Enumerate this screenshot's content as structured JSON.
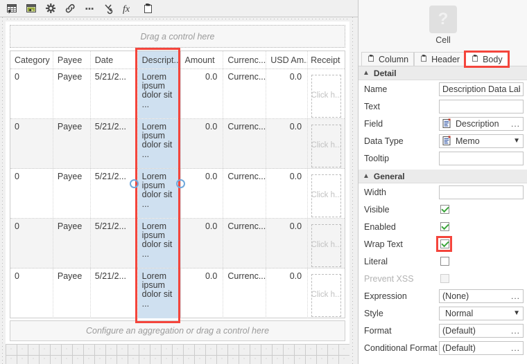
{
  "toolbar": {
    "buttons": [
      {
        "name": "insert-table-icon",
        "title": "Insert Table"
      },
      {
        "name": "insert-image-icon",
        "title": "Insert Image"
      },
      {
        "name": "settings-gear-icon",
        "title": "Settings"
      },
      {
        "name": "link-icon",
        "title": "Link"
      },
      {
        "name": "more-options-icon",
        "title": "More"
      },
      {
        "name": "convert-icon",
        "title": "Convert"
      },
      {
        "name": "function-fx-icon",
        "title": "Function"
      },
      {
        "name": "paste-control-icon",
        "title": "Paste Control"
      }
    ]
  },
  "designer": {
    "header_dropzone": "Drag a control here",
    "footer_dropzone": "Configure an aggregation or drag a control here",
    "table": {
      "columns": [
        {
          "key": "category",
          "header": "Category",
          "align": "left"
        },
        {
          "key": "payee",
          "header": "Payee",
          "align": "left"
        },
        {
          "key": "date",
          "header": "Date",
          "align": "left"
        },
        {
          "key": "description",
          "header": "Descript...",
          "align": "left",
          "selected": true
        },
        {
          "key": "amount",
          "header": "Amount",
          "align": "right"
        },
        {
          "key": "currency",
          "header": "Currenc...",
          "align": "left"
        },
        {
          "key": "usd_amount",
          "header": "USD Am...",
          "align": "right"
        },
        {
          "key": "receipt",
          "header": "Receipt",
          "align": "left"
        }
      ],
      "rows": [
        {
          "category": "0",
          "payee": "Payee",
          "date": "5/21/2...",
          "description": "Lorem ipsum dolor sit ...",
          "amount": "0.0",
          "currency": "Currenc...",
          "usd_amount": "0.0",
          "receipt": "Click h..."
        },
        {
          "category": "0",
          "payee": "Payee",
          "date": "5/21/2...",
          "description": "Lorem ipsum dolor sit ...",
          "amount": "0.0",
          "currency": "Currenc...",
          "usd_amount": "0.0",
          "receipt": "Click h..."
        },
        {
          "category": "0",
          "payee": "Payee",
          "date": "5/21/2...",
          "description": "Lorem ipsum dolor sit ...",
          "amount": "0.0",
          "currency": "Currenc...",
          "usd_amount": "0.0",
          "receipt": "Click h..."
        },
        {
          "category": "0",
          "payee": "Payee",
          "date": "5/21/2...",
          "description": "Lorem ipsum dolor sit ...",
          "amount": "0.0",
          "currency": "Currenc...",
          "usd_amount": "0.0",
          "receipt": "Click h..."
        },
        {
          "category": "0",
          "payee": "Payee",
          "date": "5/21/2...",
          "description": "Lorem ipsum dolor sit ...",
          "amount": "0.0",
          "currency": "Currenc...",
          "usd_amount": "0.0",
          "receipt": "Click h..."
        }
      ]
    }
  },
  "properties": {
    "thumbnail_glyph": "?",
    "title": "Cell",
    "tabs": [
      {
        "label": "Column",
        "active": false,
        "highlighted": false
      },
      {
        "label": "Header",
        "active": false,
        "highlighted": false
      },
      {
        "label": "Body",
        "active": true,
        "highlighted": true
      }
    ],
    "sections": [
      {
        "title": "Detail",
        "collapsed": false,
        "rows": [
          {
            "label": "Name",
            "type": "text",
            "value": "Description Data Labe"
          },
          {
            "label": "Text",
            "type": "text",
            "value": ""
          },
          {
            "label": "Field",
            "type": "picker",
            "value": "Description",
            "icon": "memo-field-icon",
            "affordance": "..."
          },
          {
            "label": "Data Type",
            "type": "dropdown",
            "value": "Memo",
            "icon": "memo-field-icon",
            "affordance": "chevron-down"
          },
          {
            "label": "Tooltip",
            "type": "text",
            "value": ""
          }
        ]
      },
      {
        "title": "General",
        "collapsed": false,
        "rows": [
          {
            "label": "Width",
            "type": "text",
            "value": ""
          },
          {
            "label": "Visible",
            "type": "checkbox",
            "checked": true,
            "disabled": false,
            "highlighted": false
          },
          {
            "label": "Enabled",
            "type": "checkbox",
            "checked": true,
            "disabled": false,
            "highlighted": false
          },
          {
            "label": "Wrap Text",
            "type": "checkbox",
            "checked": true,
            "disabled": false,
            "highlighted": true
          },
          {
            "label": "Literal",
            "type": "checkbox",
            "checked": false,
            "disabled": false,
            "highlighted": false
          },
          {
            "label": "Prevent XSS",
            "type": "checkbox",
            "checked": false,
            "disabled": true,
            "highlighted": false
          },
          {
            "label": "Expression",
            "type": "picker",
            "value": "(None)",
            "affordance": "..."
          },
          {
            "label": "Style",
            "type": "dropdown",
            "value": "Normal",
            "affordance": "chevron-down"
          },
          {
            "label": "Format",
            "type": "picker",
            "value": "(Default)",
            "affordance": "..."
          },
          {
            "label": "Conditional Format",
            "type": "picker",
            "value": "(Default)",
            "affordance": "..."
          }
        ]
      }
    ]
  },
  "annotations": {
    "column_highlight_color": "#f4453c",
    "checkbox_highlight_color": "#f4453c",
    "tab_highlight_color": "#f4453c",
    "selection_tint_color": "#cfe0f0",
    "resize_handle_color": "#6fa8dc"
  }
}
